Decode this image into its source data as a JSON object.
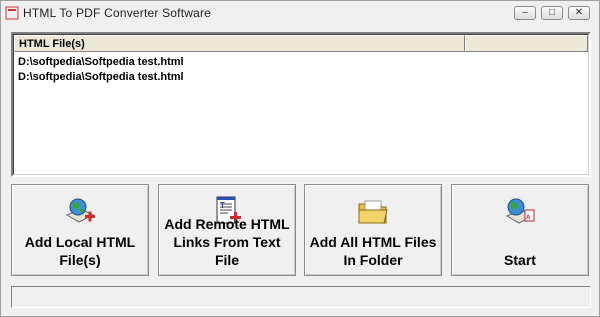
{
  "window": {
    "title": "HTML To PDF Converter Software",
    "min_label": "–",
    "max_label": "□",
    "close_label": "✕"
  },
  "list": {
    "columns": [
      "HTML File(s)",
      ""
    ],
    "rows": [
      "D:\\softpedia\\Softpedia test.html",
      "D:\\softpedia\\Softpedia test.html"
    ]
  },
  "buttons": [
    {
      "label": "Add Local HTML\nFile(s)",
      "icon": "globe-add-icon"
    },
    {
      "label": "Add Remote HTML\nLinks From Text\nFile",
      "icon": "text-file-add-icon"
    },
    {
      "label": "Add All HTML Files\nIn Folder",
      "icon": "folder-icon"
    },
    {
      "label": "Start",
      "icon": "globe-convert-icon"
    }
  ],
  "status": {
    "text": ""
  }
}
